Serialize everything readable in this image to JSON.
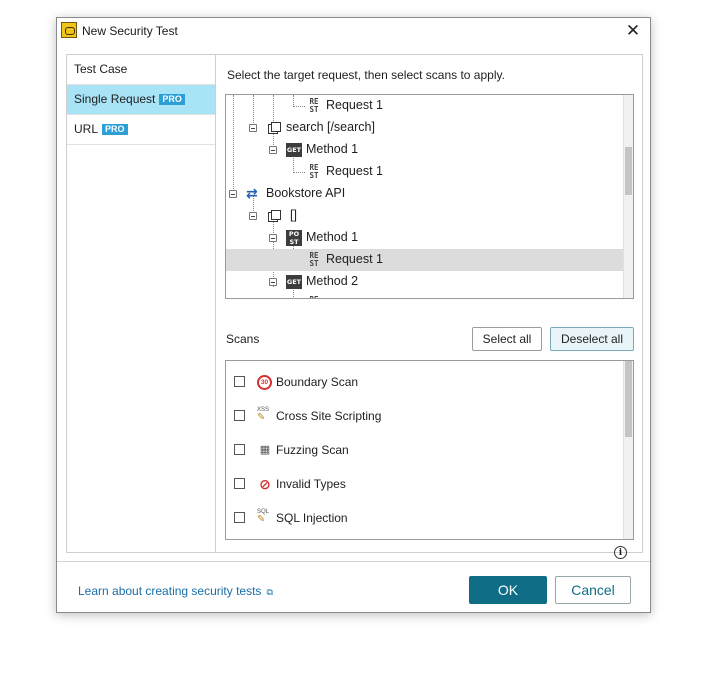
{
  "window": {
    "title": "New Security Test",
    "close_glyph": "✕"
  },
  "sidebar": {
    "items": [
      {
        "label": "Test Case",
        "badge": ""
      },
      {
        "label": "Single Request",
        "badge": "PRO"
      },
      {
        "label": "URL",
        "badge": "PRO"
      }
    ]
  },
  "main": {
    "instruction": "Select the target request, then select scans to apply.",
    "tree": [
      {
        "label": "Request 1",
        "icon": "rest-request-icon",
        "icon_text": "RE ST"
      },
      {
        "label": "search [/search]",
        "icon": "resource-icon"
      },
      {
        "label": "Method 1",
        "icon": "get-method-icon",
        "icon_text": "GET"
      },
      {
        "label": "Request 1",
        "icon": "rest-request-icon",
        "icon_text": "RE ST"
      },
      {
        "label": "Bookstore API",
        "icon": "api-icon"
      },
      {
        "label": "[]",
        "icon": "resource-icon"
      },
      {
        "label": "Method 1",
        "icon": "post-method-icon",
        "icon_text": "PO ST"
      },
      {
        "label": "Request 1",
        "icon": "rest-request-icon",
        "icon_text": "RE ST",
        "selected": true
      },
      {
        "label": "Method 2",
        "icon": "get-method-icon",
        "icon_text": "GET"
      }
    ],
    "scans_label": "Scans",
    "select_all": "Select all",
    "deselect_all": "Deselect all",
    "scans": [
      {
        "label": "Boundary Scan",
        "icon": "boundary-scan-icon",
        "icon_text": "30",
        "checked": false
      },
      {
        "label": "Cross Site Scripting",
        "icon": "xss-icon",
        "icon_text": "XSS",
        "checked": false
      },
      {
        "label": "Fuzzing Scan",
        "icon": "fuzzing-icon",
        "checked": false
      },
      {
        "label": "Invalid Types",
        "icon": "invalid-types-icon",
        "checked": false
      },
      {
        "label": "SQL Injection",
        "icon": "sql-injection-icon",
        "icon_text": "SQL",
        "checked": false
      }
    ],
    "info_glyph": "i"
  },
  "footer": {
    "learn_link": "Learn about creating security tests",
    "ok": "OK",
    "cancel": "Cancel"
  },
  "colors": {
    "accent": "#0f6e86",
    "selected_nav": "#a9e3f6",
    "pro_badge": "#2d9fd6",
    "link": "#1a6ea8"
  }
}
